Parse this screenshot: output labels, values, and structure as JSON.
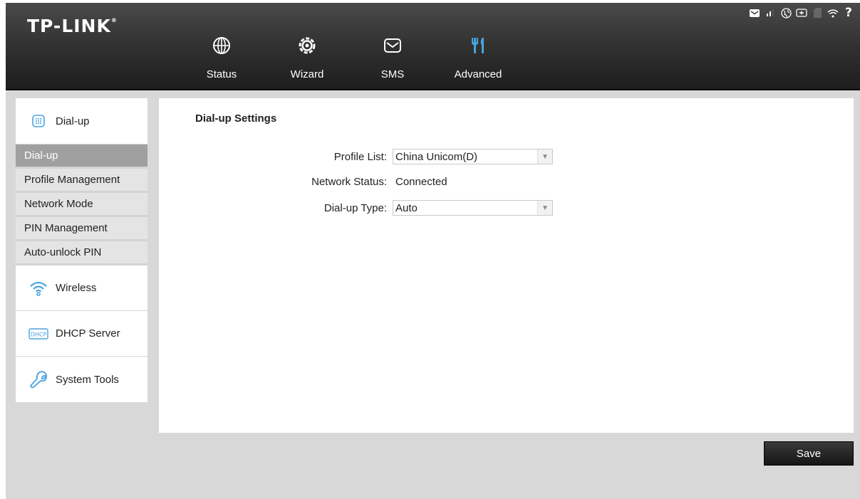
{
  "header": {
    "logo": "TP-LINK",
    "logo_mark": "®",
    "nav": [
      {
        "label": "Status",
        "icon": "globe-icon"
      },
      {
        "label": "Wizard",
        "icon": "gear-icon"
      },
      {
        "label": "SMS",
        "icon": "envelope-icon"
      },
      {
        "label": "Advanced",
        "icon": "tools-icon"
      }
    ],
    "status_icons": [
      "message-icon",
      "signal-icon",
      "internet-icon",
      "battery-icon",
      "sd-card-icon",
      "wifi-icon",
      "help-icon"
    ],
    "accent_color": "#4aa3df"
  },
  "sidebar": {
    "groups": [
      {
        "label": "Dial-up",
        "icon": "dialpad-icon",
        "items": [
          "Dial-up",
          "Profile Management",
          "Network Mode",
          "PIN Management",
          "Auto-unlock PIN"
        ],
        "active_item": "Dial-up"
      },
      {
        "label": "Wireless",
        "icon": "wifi-icon"
      },
      {
        "label": "DHCP Server",
        "icon": "dhcp-icon"
      },
      {
        "label": "System Tools",
        "icon": "wrench-icon"
      }
    ]
  },
  "main": {
    "title": "Dial-up Settings",
    "fields": [
      {
        "label": "Profile List:",
        "value": "China Unicom(D)",
        "type": "select"
      },
      {
        "label": "Network Status:",
        "value": "Connected",
        "type": "text"
      },
      {
        "label": "Dial-up Type:",
        "value": "Auto",
        "type": "select"
      }
    ],
    "save_label": "Save"
  }
}
